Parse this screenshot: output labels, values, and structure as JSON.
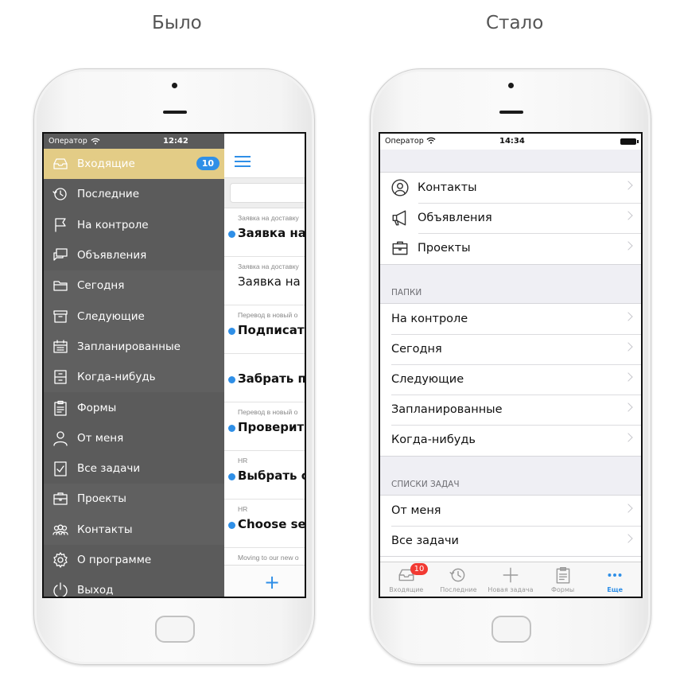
{
  "captions": {
    "before": "Было",
    "after": "Стало"
  },
  "colors": {
    "accent": "#2f8fe7",
    "menu_bg": "#5a5a5a",
    "menu_active": "#e3cc86",
    "badge_red": "#f23a33"
  },
  "left_phone": {
    "status": {
      "carrier": "Оператор",
      "time": "12:42"
    },
    "menu": [
      {
        "label": "Входящие",
        "icon": "inbox-icon",
        "badge": "10",
        "active": true
      },
      {
        "label": "Последние",
        "icon": "history-icon"
      },
      {
        "label": "На контроле",
        "icon": "flag-icon"
      },
      {
        "label": "Объявления",
        "icon": "chat-icon"
      },
      {
        "label": "Сегодня",
        "icon": "folder-icon"
      },
      {
        "label": "Следующие",
        "icon": "archive-icon"
      },
      {
        "label": "Запланированные",
        "icon": "calendar-icon"
      },
      {
        "label": "Когда-нибудь",
        "icon": "cabinet-icon"
      },
      {
        "label": "Формы",
        "icon": "clipboard-icon"
      },
      {
        "label": "От меня",
        "icon": "user-icon"
      },
      {
        "label": "Все задачи",
        "icon": "checklist-icon"
      },
      {
        "label": "Проекты",
        "icon": "briefcase-icon"
      },
      {
        "label": "Контакты",
        "icon": "group-icon"
      },
      {
        "label": "О программе",
        "icon": "gear-icon"
      },
      {
        "label": "Выход",
        "icon": "power-icon"
      }
    ],
    "tasks": [
      {
        "sub": "Заявка на доставку",
        "title": "Заявка на",
        "unread": true
      },
      {
        "sub": "Заявка на доставку",
        "title": "Заявка на Д",
        "unread": false
      },
      {
        "sub": "Перевод в новый о",
        "title": "Подписать",
        "unread": true
      },
      {
        "sub": "",
        "title": "Забрать пр",
        "unread": true
      },
      {
        "sub": "Перевод в новый о",
        "title": "Проверить",
        "unread": true
      },
      {
        "sub": "HR",
        "title": "Выбрать со",
        "unread": true
      },
      {
        "sub": "HR",
        "title": "Choose sec",
        "unread": true
      },
      {
        "sub": "Moving to our new o",
        "title": "",
        "unread": false
      }
    ],
    "add_label": "+"
  },
  "right_phone": {
    "status": {
      "carrier": "Оператор",
      "time": "14:34"
    },
    "top_group": [
      {
        "label": "Контакты",
        "icon": "contact-icon"
      },
      {
        "label": "Объявления",
        "icon": "megaphone-icon"
      },
      {
        "label": "Проекты",
        "icon": "briefcase-icon"
      }
    ],
    "folders_header": "ПАПКИ",
    "folders": [
      "На контроле",
      "Сегодня",
      "Следующие",
      "Запланированные",
      "Когда-нибудь"
    ],
    "lists_header": "СПИСКИ ЗАДАЧ",
    "lists": [
      "От меня",
      "Все задачи"
    ],
    "tabs": [
      {
        "label": "Входящие",
        "icon": "inbox-icon",
        "badge": "10",
        "active": false
      },
      {
        "label": "Последние",
        "icon": "history-icon",
        "active": false
      },
      {
        "label": "Новая задача",
        "icon": "plus-icon",
        "active": false
      },
      {
        "label": "Формы",
        "icon": "clipboard-icon",
        "active": false
      },
      {
        "label": "Еще",
        "icon": "more-icon",
        "active": true
      }
    ]
  }
}
